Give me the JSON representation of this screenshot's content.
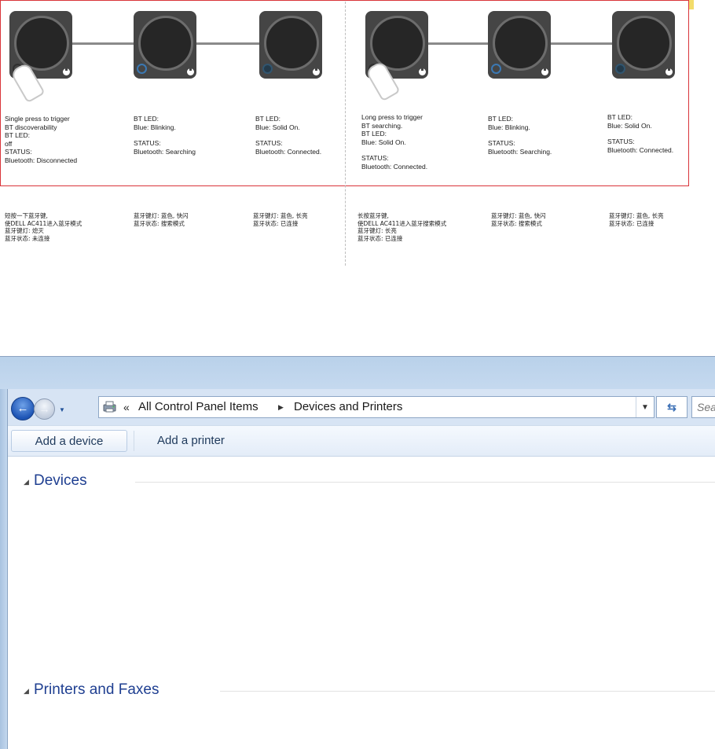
{
  "figure": {
    "short_press": {
      "step1": [
        "Single press to trigger",
        "BT discoverability",
        "BT LED:",
        "off",
        "STATUS:",
        "Bluetooth: Disconnected"
      ],
      "step2": {
        "led_label": "BT LED:",
        "led_state": "Blue: Blinking.",
        "status_label": "STATUS:",
        "status_value": "Bluetooth: Searching"
      },
      "step3": {
        "led_label": "BT LED:",
        "led_state": "Blue: Solid On.",
        "status_label": "STATUS:",
        "status_value": "Bluetooth: Connected."
      },
      "zh": [
        [
          "短按一下蓝牙键,",
          "使DELL AC411进入蓝牙模式",
          "蓝牙键灯: 熄灭",
          "蓝牙状态: 未连接"
        ],
        [
          "蓝牙键灯: 蓝色, 快闪",
          "蓝牙状态: 搜索模式"
        ],
        [
          "蓝牙键灯: 蓝色, 长亮",
          "蓝牙状态: 已连接"
        ]
      ]
    },
    "long_press": {
      "step1": {
        "lines": [
          "Long press to trigger",
          "BT searching.",
          "BT LED:",
          "Blue: Solid On."
        ],
        "status_label": "STATUS:",
        "status_value": "Bluetooth: Connected."
      },
      "step2": {
        "led_label": "BT LED:",
        "led_state": "Blue: Blinking.",
        "status_label": "STATUS:",
        "status_value": "Bluetooth: Searching."
      },
      "step3": {
        "led_label": "BT LED:",
        "led_state": "Blue: Solid On.",
        "status_label": "STATUS:",
        "status_value": "Bluetooth: Connected."
      },
      "zh": [
        [
          "长按蓝牙键,",
          "使DELL AC411进入蓝牙搜索模式",
          "蓝牙键灯: 长亮",
          "蓝牙状态: 已连接"
        ],
        [
          "蓝牙键灯: 蓝色, 快闪",
          "蓝牙状态: 搜索模式"
        ],
        [
          "蓝牙键灯: 蓝色, 长亮",
          "蓝牙状态: 已连接"
        ]
      ]
    }
  },
  "explorer": {
    "address": {
      "overflow": "«",
      "crumbs": [
        "All Control Panel Items",
        "Devices and Printers"
      ]
    },
    "search_placeholder": "Search Devices and Printers",
    "toolbar": {
      "add_device": "Add a device",
      "add_printer": "Add a printer"
    },
    "groups": {
      "devices": "Devices",
      "printers": "Printers and Faxes"
    }
  }
}
